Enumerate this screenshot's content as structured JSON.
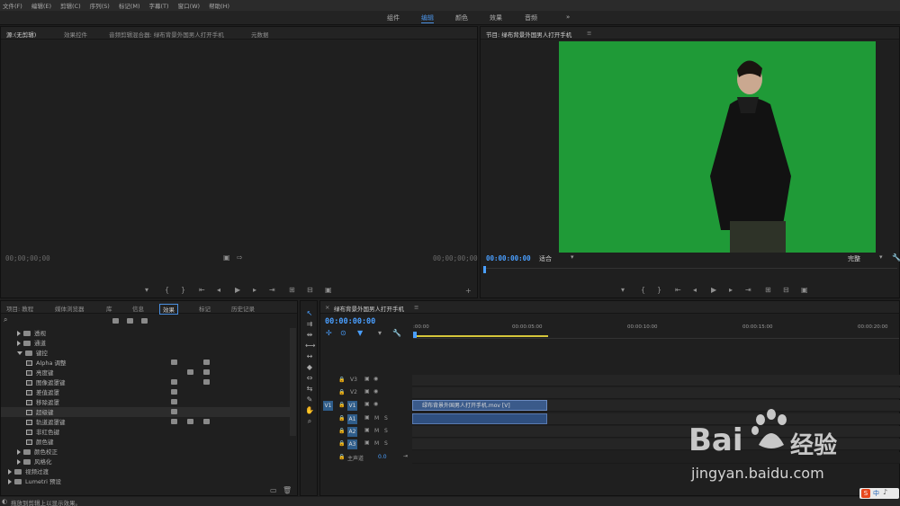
{
  "menu": [
    "文件(F)",
    "编辑(E)",
    "剪辑(C)",
    "序列(S)",
    "标记(M)",
    "字幕(T)",
    "窗口(W)",
    "帮助(H)"
  ],
  "workspace_tabs": [
    "组件",
    "编辑",
    "颜色",
    "效果",
    "音频"
  ],
  "workspace_more": "»",
  "source_panel": {
    "tabs": [
      "源:(无剪辑)",
      "效果控件",
      "音频剪辑混合器: 绿布背景外国男人打开手机",
      "元数据"
    ],
    "tc_left": "00;00;00;00",
    "tc_right": "00;00;00;00"
  },
  "program_panel": {
    "title": "节目: 绿布背景外国男人打开手机",
    "timecode": "00:00:00:00",
    "fit": "适合",
    "quality": "完整"
  },
  "project_panel": {
    "tabs": [
      "项目: 教程",
      "媒体浏览器",
      "库",
      "信息",
      "效果",
      "标记",
      "历史记录"
    ],
    "tree": [
      {
        "label": "透视",
        "indent": 1,
        "type": "folder"
      },
      {
        "label": "通道",
        "indent": 1,
        "type": "folder"
      },
      {
        "label": "键控",
        "indent": 1,
        "type": "folder-open"
      },
      {
        "label": "Alpha 调整",
        "indent": 2,
        "type": "fx"
      },
      {
        "label": "亮度键",
        "indent": 2,
        "type": "fx"
      },
      {
        "label": "图像遮罩键",
        "indent": 2,
        "type": "fx"
      },
      {
        "label": "差值遮罩",
        "indent": 2,
        "type": "fx"
      },
      {
        "label": "移除遮罩",
        "indent": 2,
        "type": "fx"
      },
      {
        "label": "超级键",
        "indent": 2,
        "type": "fx",
        "selected": true
      },
      {
        "label": "轨道遮罩键",
        "indent": 2,
        "type": "fx"
      },
      {
        "label": "非红色键",
        "indent": 2,
        "type": "fx"
      },
      {
        "label": "颜色键",
        "indent": 2,
        "type": "fx"
      },
      {
        "label": "颜色校正",
        "indent": 1,
        "type": "folder"
      },
      {
        "label": "风格化",
        "indent": 1,
        "type": "folder"
      },
      {
        "label": "视频过渡",
        "indent": 0,
        "type": "folder"
      },
      {
        "label": "Lumetri 预设",
        "indent": 0,
        "type": "folder"
      }
    ]
  },
  "timeline": {
    "title": "绿布背景外国男人打开手机",
    "timecode": "00:00:00:00",
    "ruler": [
      ":00:00",
      "00:00:05:00",
      "00:00:10:00",
      "00:00:15:00",
      "00:00:20:00"
    ],
    "video_tracks": [
      "V3",
      "V2",
      "V1"
    ],
    "audio_tracks": [
      "A1",
      "A2",
      "A3"
    ],
    "master_label": "主声道",
    "master_value": "0.0",
    "clip_name": "绿布背景外国男人打开手机.mov [V]",
    "mute": "M",
    "solo": "S"
  },
  "status_bar": "拖放到剪辑上以显示效果。",
  "watermark": {
    "brand": "Bai",
    "brand2": "经验",
    "url": "jingyan.baidu.com"
  },
  "tray_text": "中",
  "colors": {
    "accent": "#4a90e2",
    "green_screen": "#1f9a37",
    "clip": "#3a5a8a"
  }
}
